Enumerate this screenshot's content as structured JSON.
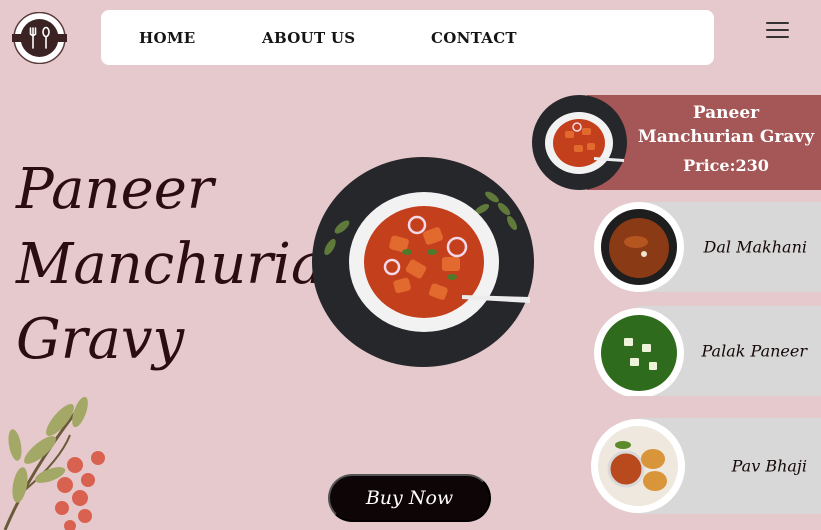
{
  "nav": {
    "links": [
      "HOME",
      "ABOUT US",
      "CONTACT"
    ]
  },
  "hero": {
    "title_lines": [
      "Paneer",
      "Manchurian",
      "Gravy"
    ],
    "buy_label": "Buy Now"
  },
  "featured": {
    "name_lines": [
      "Paneer",
      "Manchurian Gravy"
    ],
    "price": "Price:230"
  },
  "menu": [
    {
      "label": "Dal Makhani",
      "icon": "dal-makhani-image"
    },
    {
      "label": "Palak Paneer",
      "icon": "palak-paneer-image"
    },
    {
      "label": "Pav Bhaji",
      "icon": "pav-bhaji-image"
    }
  ],
  "colors": {
    "background": "#e6c9cc",
    "featured_card": "#a45756",
    "menu_card": "#d9d8d8",
    "button": "#0d0506"
  }
}
